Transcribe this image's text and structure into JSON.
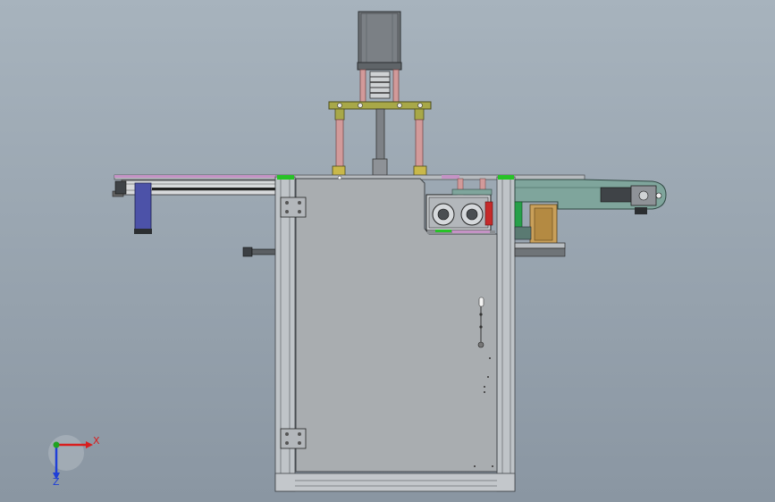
{
  "view": {
    "background_top": "#a7b3bd",
    "background_bottom": "#8a96a2"
  },
  "triad": {
    "x_label": "X",
    "z_label": "Z",
    "x_color": "#d81e1e",
    "y_color": "#1fa31f",
    "z_color": "#1f3fd8"
  },
  "colors": {
    "frame": "#b9bec2",
    "frame_dark": "#5d6266",
    "panel": "#a9adb0",
    "motor": "#6f7478",
    "pillar": "#d29a9a",
    "plate": "#a8a848",
    "bearing": "#c9b84a",
    "conveyor": "#7fa59c",
    "accent_green": "#27c227",
    "accent_purple": "#c593c5",
    "cylinder_blue": "#4c52a8",
    "bracket_tan": "#c9a05a"
  }
}
